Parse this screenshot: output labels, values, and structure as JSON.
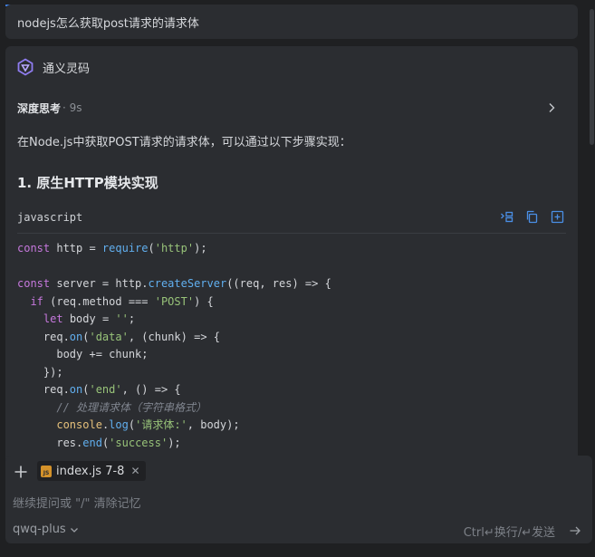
{
  "user_message": "nodejs怎么获取post请求的请求体",
  "assistant": {
    "name": "通义灵码",
    "thinking_label": "深度思考",
    "thinking_time": "· 9s",
    "intro": "在Node.js中获取POST请求的请求体，可以通过以下步骤实现：",
    "heading": "1. 原生HTTP模块实现",
    "code_language": "javascript"
  },
  "code_lines": [
    "const http = require('http');",
    "",
    "const server = http.createServer((req, res) => {",
    "  if (req.method === 'POST') {",
    "    let body = '';",
    "    req.on('data', (chunk) => {",
    "      body += chunk;",
    "    });",
    "    req.on('end', () => {",
    "      // 处理请求体（字符串格式）",
    "      console.log('请求体:', body);",
    "      res.end('success');"
  ],
  "input": {
    "context_file": "index.js 7-8",
    "placeholder": "继续提问或 \"/\" 清除记忆",
    "model": "qwq-plus",
    "hint": "Ctrl↵换行/↵发送"
  },
  "colors": {
    "accent": "#3f7fe0",
    "keyword": "#c678dd",
    "function": "#61afef",
    "string": "#98c379",
    "comment": "#7f848e"
  }
}
